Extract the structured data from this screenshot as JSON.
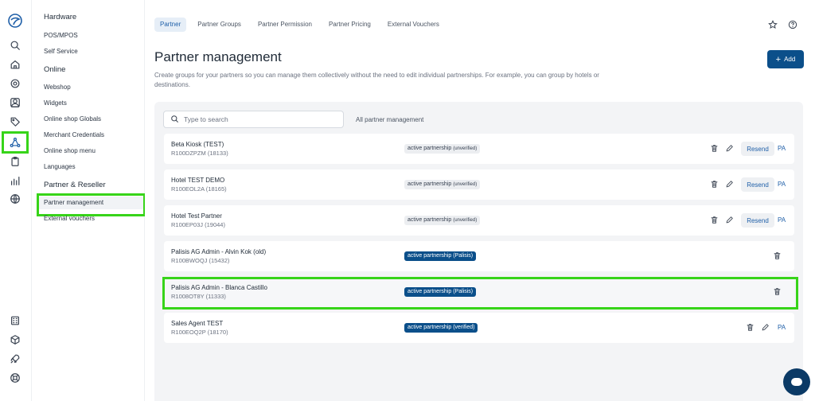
{
  "app": {
    "accent": "#0b4f8a",
    "highlight": "#37d419"
  },
  "rail": {
    "icons": [
      "logo-icon",
      "search-icon",
      "home-icon",
      "gear-icon",
      "contacts-icon",
      "tag-icon",
      "partner-network-icon",
      "clipboard-icon",
      "bar-chart-icon",
      "globe-icon",
      "building-icon",
      "box-icon",
      "rocket-icon",
      "lifebuoy-icon"
    ]
  },
  "subnav": {
    "sections": [
      {
        "title": "Hardware",
        "items": [
          "POS/MPOS",
          "Self Service"
        ]
      },
      {
        "title": "Online",
        "items": [
          "Webshop",
          "Widgets",
          "Online shop Globals",
          "Merchant Credentials",
          "Online shop menu",
          "Languages"
        ]
      },
      {
        "title": "Partner & Reseller",
        "items": [
          "Partner management",
          "External vouchers"
        ]
      }
    ]
  },
  "tabs": [
    "Partner",
    "Partner Groups",
    "Partner Permission",
    "Partner Pricing",
    "External Vouchers"
  ],
  "page": {
    "title": "Partner management",
    "description": "Create groups for your partners so you can manage them collectively without the need to edit individual partnerships. For example, you can group by hotels or destinations.",
    "add_label": "Add"
  },
  "filters": {
    "search_placeholder": "Type to search",
    "all_label": "All partner management"
  },
  "partners": [
    {
      "name": "Beta Kiosk (TEST)",
      "code": "R100DZPZM (18133)",
      "status": "active partnership",
      "status_note": "(unverified)",
      "kind": "unverified",
      "resend": "Resend",
      "pa": "PA"
    },
    {
      "name": "Hotel TEST DEMO",
      "code": "R100EOL2A (18165)",
      "status": "active partnership",
      "status_note": "(unverified)",
      "kind": "unverified",
      "resend": "Resend",
      "pa": "PA"
    },
    {
      "name": "Hotel Test Partner",
      "code": "R100EP03J (19044)",
      "status": "active partnership",
      "status_note": "(unverified)",
      "kind": "unverified",
      "resend": "Resend",
      "pa": "PA"
    },
    {
      "name": "Palisis AG Admin - Alvin Kok (old)",
      "code": "R100BWOQJ (15432)",
      "status": "active partnership",
      "status_note": "(Palisis)",
      "kind": "palisis"
    },
    {
      "name": "Palisis AG Admin - Blanca Castillo",
      "code": "R1008OT8Y (11333)",
      "status": "active partnership",
      "status_note": "(Palisis)",
      "kind": "palisis"
    },
    {
      "name": "Sales Agent TEST",
      "code": "R100EOQ2P (18170)",
      "status": "active partnership",
      "status_note": "(verified)",
      "kind": "verified",
      "pa": "PA"
    }
  ]
}
